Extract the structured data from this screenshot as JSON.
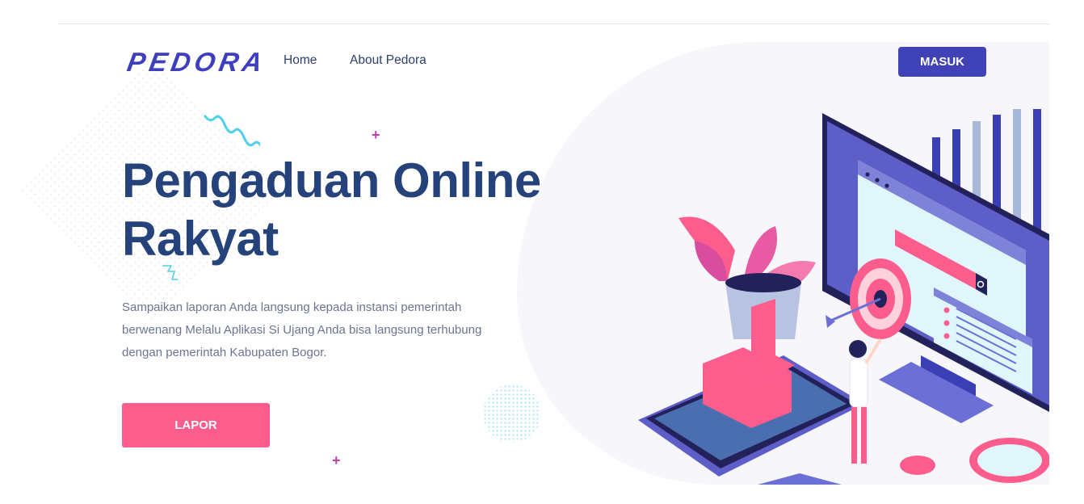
{
  "brand": {
    "logo_text": "PEDORA"
  },
  "nav": {
    "items": [
      {
        "label": "Home"
      },
      {
        "label": "About Pedora"
      }
    ]
  },
  "header": {
    "login_label": "MASUK"
  },
  "hero": {
    "title_line1": "Pengaduan Online",
    "title_line2": "Rakyat",
    "description": "Sampaikan laporan Anda langsung kepada instansi pemerintah berwenang Melalu Aplikasi Si Ujang Anda bisa langsung terhubung dengan pemerintah Kabupaten Bogor.",
    "cta_label": "LAPOR"
  },
  "icons": {
    "decorations": [
      "squiggle-icon",
      "zigzag-icon",
      "plus-icon"
    ],
    "illustration": "online-complaint-illustration"
  },
  "colors": {
    "brand": "#3e3fbf",
    "title": "#25427a",
    "cta": "#fc5d8d",
    "login_button": "#4042b8"
  }
}
